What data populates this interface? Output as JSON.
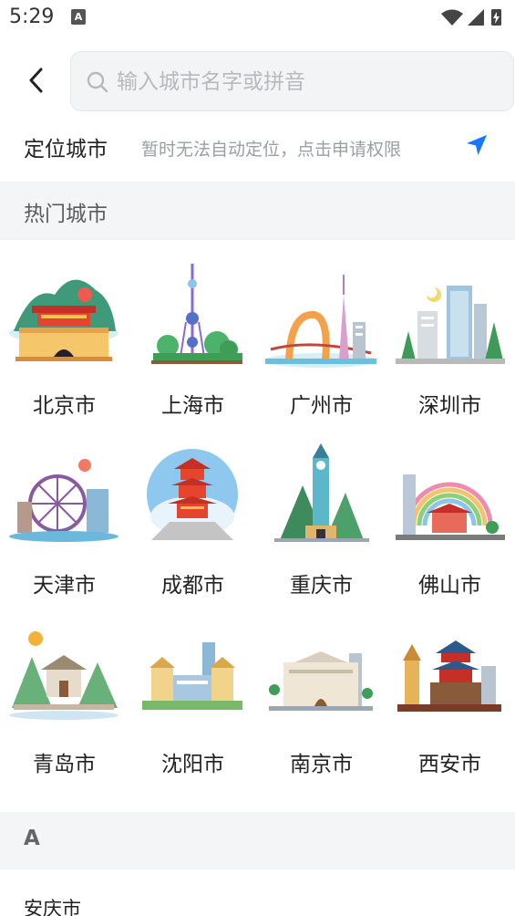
{
  "status_bar": {
    "time": "5:29",
    "badge": "A"
  },
  "header": {
    "search_placeholder": "输入城市名字或拼音"
  },
  "locate": {
    "title": "定位城市",
    "hint": "暂时无法自动定位，点击申请权限"
  },
  "hot_section": {
    "title": "热门城市"
  },
  "hot_cities": [
    {
      "name": "北京市",
      "icon": "beijing-tiananmen"
    },
    {
      "name": "上海市",
      "icon": "shanghai-tower"
    },
    {
      "name": "广州市",
      "icon": "guangzhou-tower"
    },
    {
      "name": "深圳市",
      "icon": "shenzhen-skyline"
    },
    {
      "name": "天津市",
      "icon": "tianjin-eye"
    },
    {
      "name": "成都市",
      "icon": "chengdu-pagoda"
    },
    {
      "name": "重庆市",
      "icon": "chongqing-tower"
    },
    {
      "name": "佛山市",
      "icon": "foshan-rainbow"
    },
    {
      "name": "青岛市",
      "icon": "qingdao-pavilion"
    },
    {
      "name": "沈阳市",
      "icon": "shenyang-palace"
    },
    {
      "name": "南京市",
      "icon": "nanjing-hall"
    },
    {
      "name": "西安市",
      "icon": "xian-bell-tower"
    }
  ],
  "alpha_section": {
    "letter": "A"
  },
  "city_list": [
    {
      "name": "安庆市"
    }
  ],
  "colors": {
    "accent": "#1677ff",
    "section_bg": "#f4f5f7"
  }
}
